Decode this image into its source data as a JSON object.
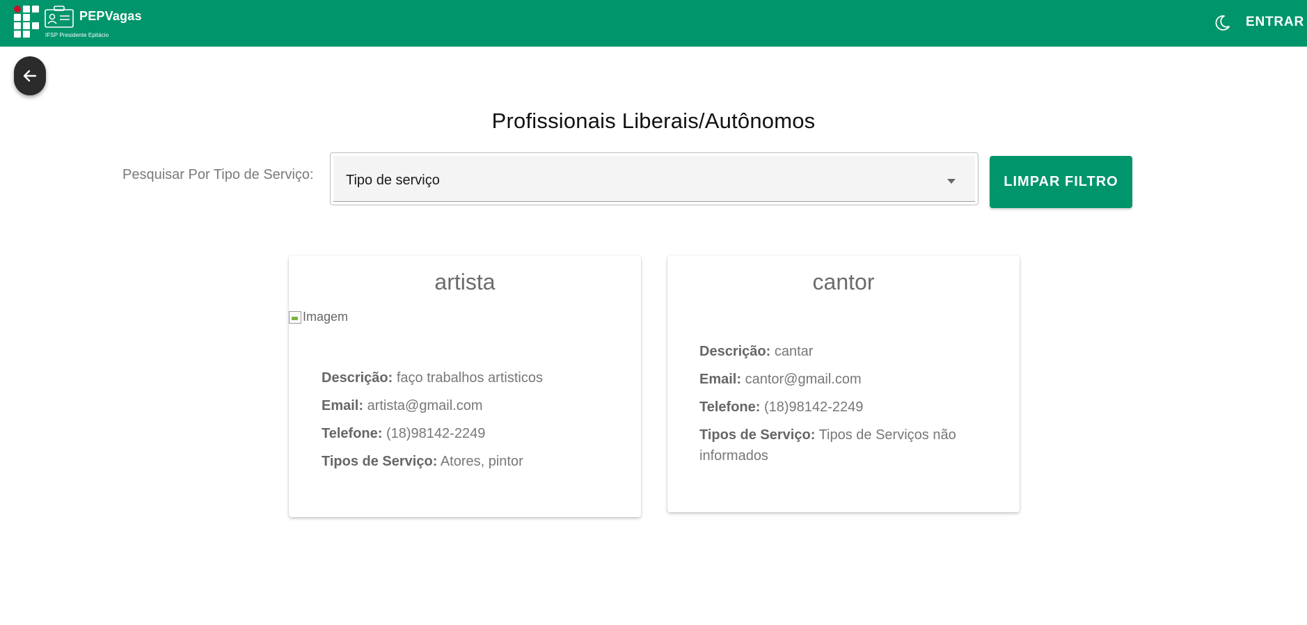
{
  "header": {
    "brand_name": "PEPVagas",
    "brand_subtitle": "IFSP Presidente Epitácio",
    "login_label": "ENTRAR",
    "theme_icon": "moon-icon",
    "bg_color": "#00956b"
  },
  "main": {
    "title": "Profissionais Liberais/Autônomos",
    "filter": {
      "label": "Pesquisar Por Tipo de Serviço:",
      "select_value": "Tipo de serviço"
    },
    "clear_button_label": "LIMPAR FILTRO",
    "cards": [
      {
        "title": "artista",
        "image_alt": "Imagem",
        "descricao_label": "Descrição:",
        "descricao": "faço trabalhos artisticos",
        "email_label": "Email:",
        "email": "artista@gmail.com",
        "telefone_label": "Telefone:",
        "telefone": "(18)98142-2249",
        "tipos_label": "Tipos de Serviço:",
        "tipos": "Atores, pintor"
      },
      {
        "title": "cantor",
        "descricao_label": "Descrição:",
        "descricao": "cantar",
        "email_label": "Email:",
        "email": "cantor@gmail.com",
        "telefone_label": "Telefone:",
        "telefone": "(18)98142-2249",
        "tipos_label": "Tipos de Serviço:",
        "tipos": "Tipos de Serviços não informados"
      }
    ]
  }
}
